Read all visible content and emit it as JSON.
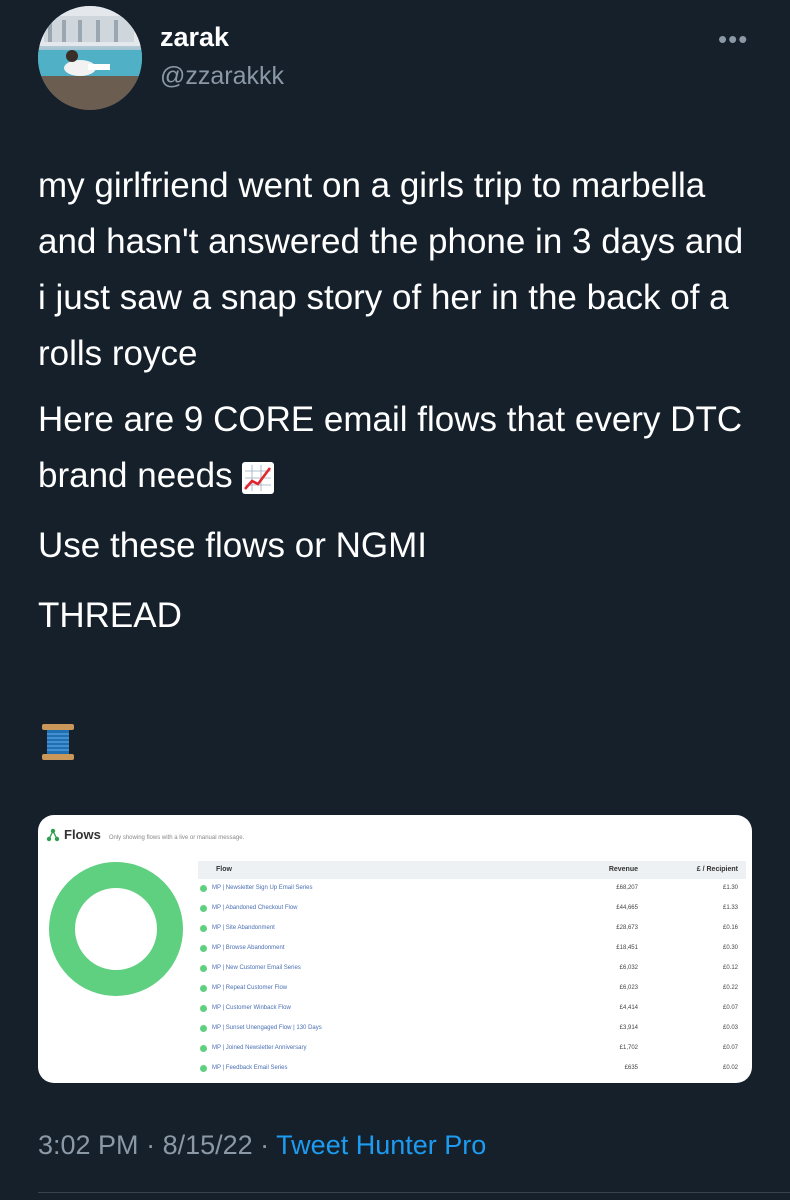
{
  "author": {
    "name": "zarak",
    "handle": "@zzarakkk",
    "more_icon": "more-horizontal-icon"
  },
  "tweet": {
    "paragraphs": [
      "my girlfriend went on a girls trip to marbella and hasn't answered the phone in 3 days and i just saw a snap story of her in the back of a rolls royce",
      "Here are 9 CORE email flows that every DTC brand needs",
      "Use these flows or NGMI",
      "THREAD"
    ],
    "emoji_chart": "chart-increasing-icon",
    "emoji_thread": "spool-of-thread-icon"
  },
  "attachment": {
    "title": "Flows",
    "note": "Only showing flows with a live or manual message.",
    "columns": {
      "flow": "Flow",
      "revenue": "Revenue",
      "recipient": "£ / Recipient"
    },
    "accent": "#5fcf80",
    "rows": [
      {
        "flow": "MP | Newsletter Sign Up Email Series",
        "revenue": "£68,207",
        "recipient": "£1.30"
      },
      {
        "flow": "MP | Abandoned Checkout Flow",
        "revenue": "£44,665",
        "recipient": "£1.33"
      },
      {
        "flow": "MP | Site Abandonment",
        "revenue": "£28,673",
        "recipient": "£0.16"
      },
      {
        "flow": "MP | Browse Abandonment",
        "revenue": "£18,451",
        "recipient": "£0.30"
      },
      {
        "flow": "MP | New Customer Email Series",
        "revenue": "£6,032",
        "recipient": "£0.12"
      },
      {
        "flow": "MP | Repeat Customer Flow",
        "revenue": "£6,023",
        "recipient": "£0.22"
      },
      {
        "flow": "MP | Customer Winback Flow",
        "revenue": "£4,414",
        "recipient": "£0.07"
      },
      {
        "flow": "MP | Sunset Unengaged Flow | 130 Days",
        "revenue": "£3,914",
        "recipient": "£0.03"
      },
      {
        "flow": "MP | Joined Newsletter Anniversary",
        "revenue": "£1,702",
        "recipient": "£0.07"
      },
      {
        "flow": "MP | Feedback Email Series",
        "revenue": "£635",
        "recipient": "£0.02"
      }
    ]
  },
  "meta": {
    "time": "3:02 PM",
    "sep1": " · ",
    "date": "8/15/22",
    "sep2": " · ",
    "source": "Tweet Hunter Pro"
  },
  "colors": {
    "background": "#15202b",
    "secondary_text": "#8b98a5",
    "link": "#1d9bf0"
  }
}
